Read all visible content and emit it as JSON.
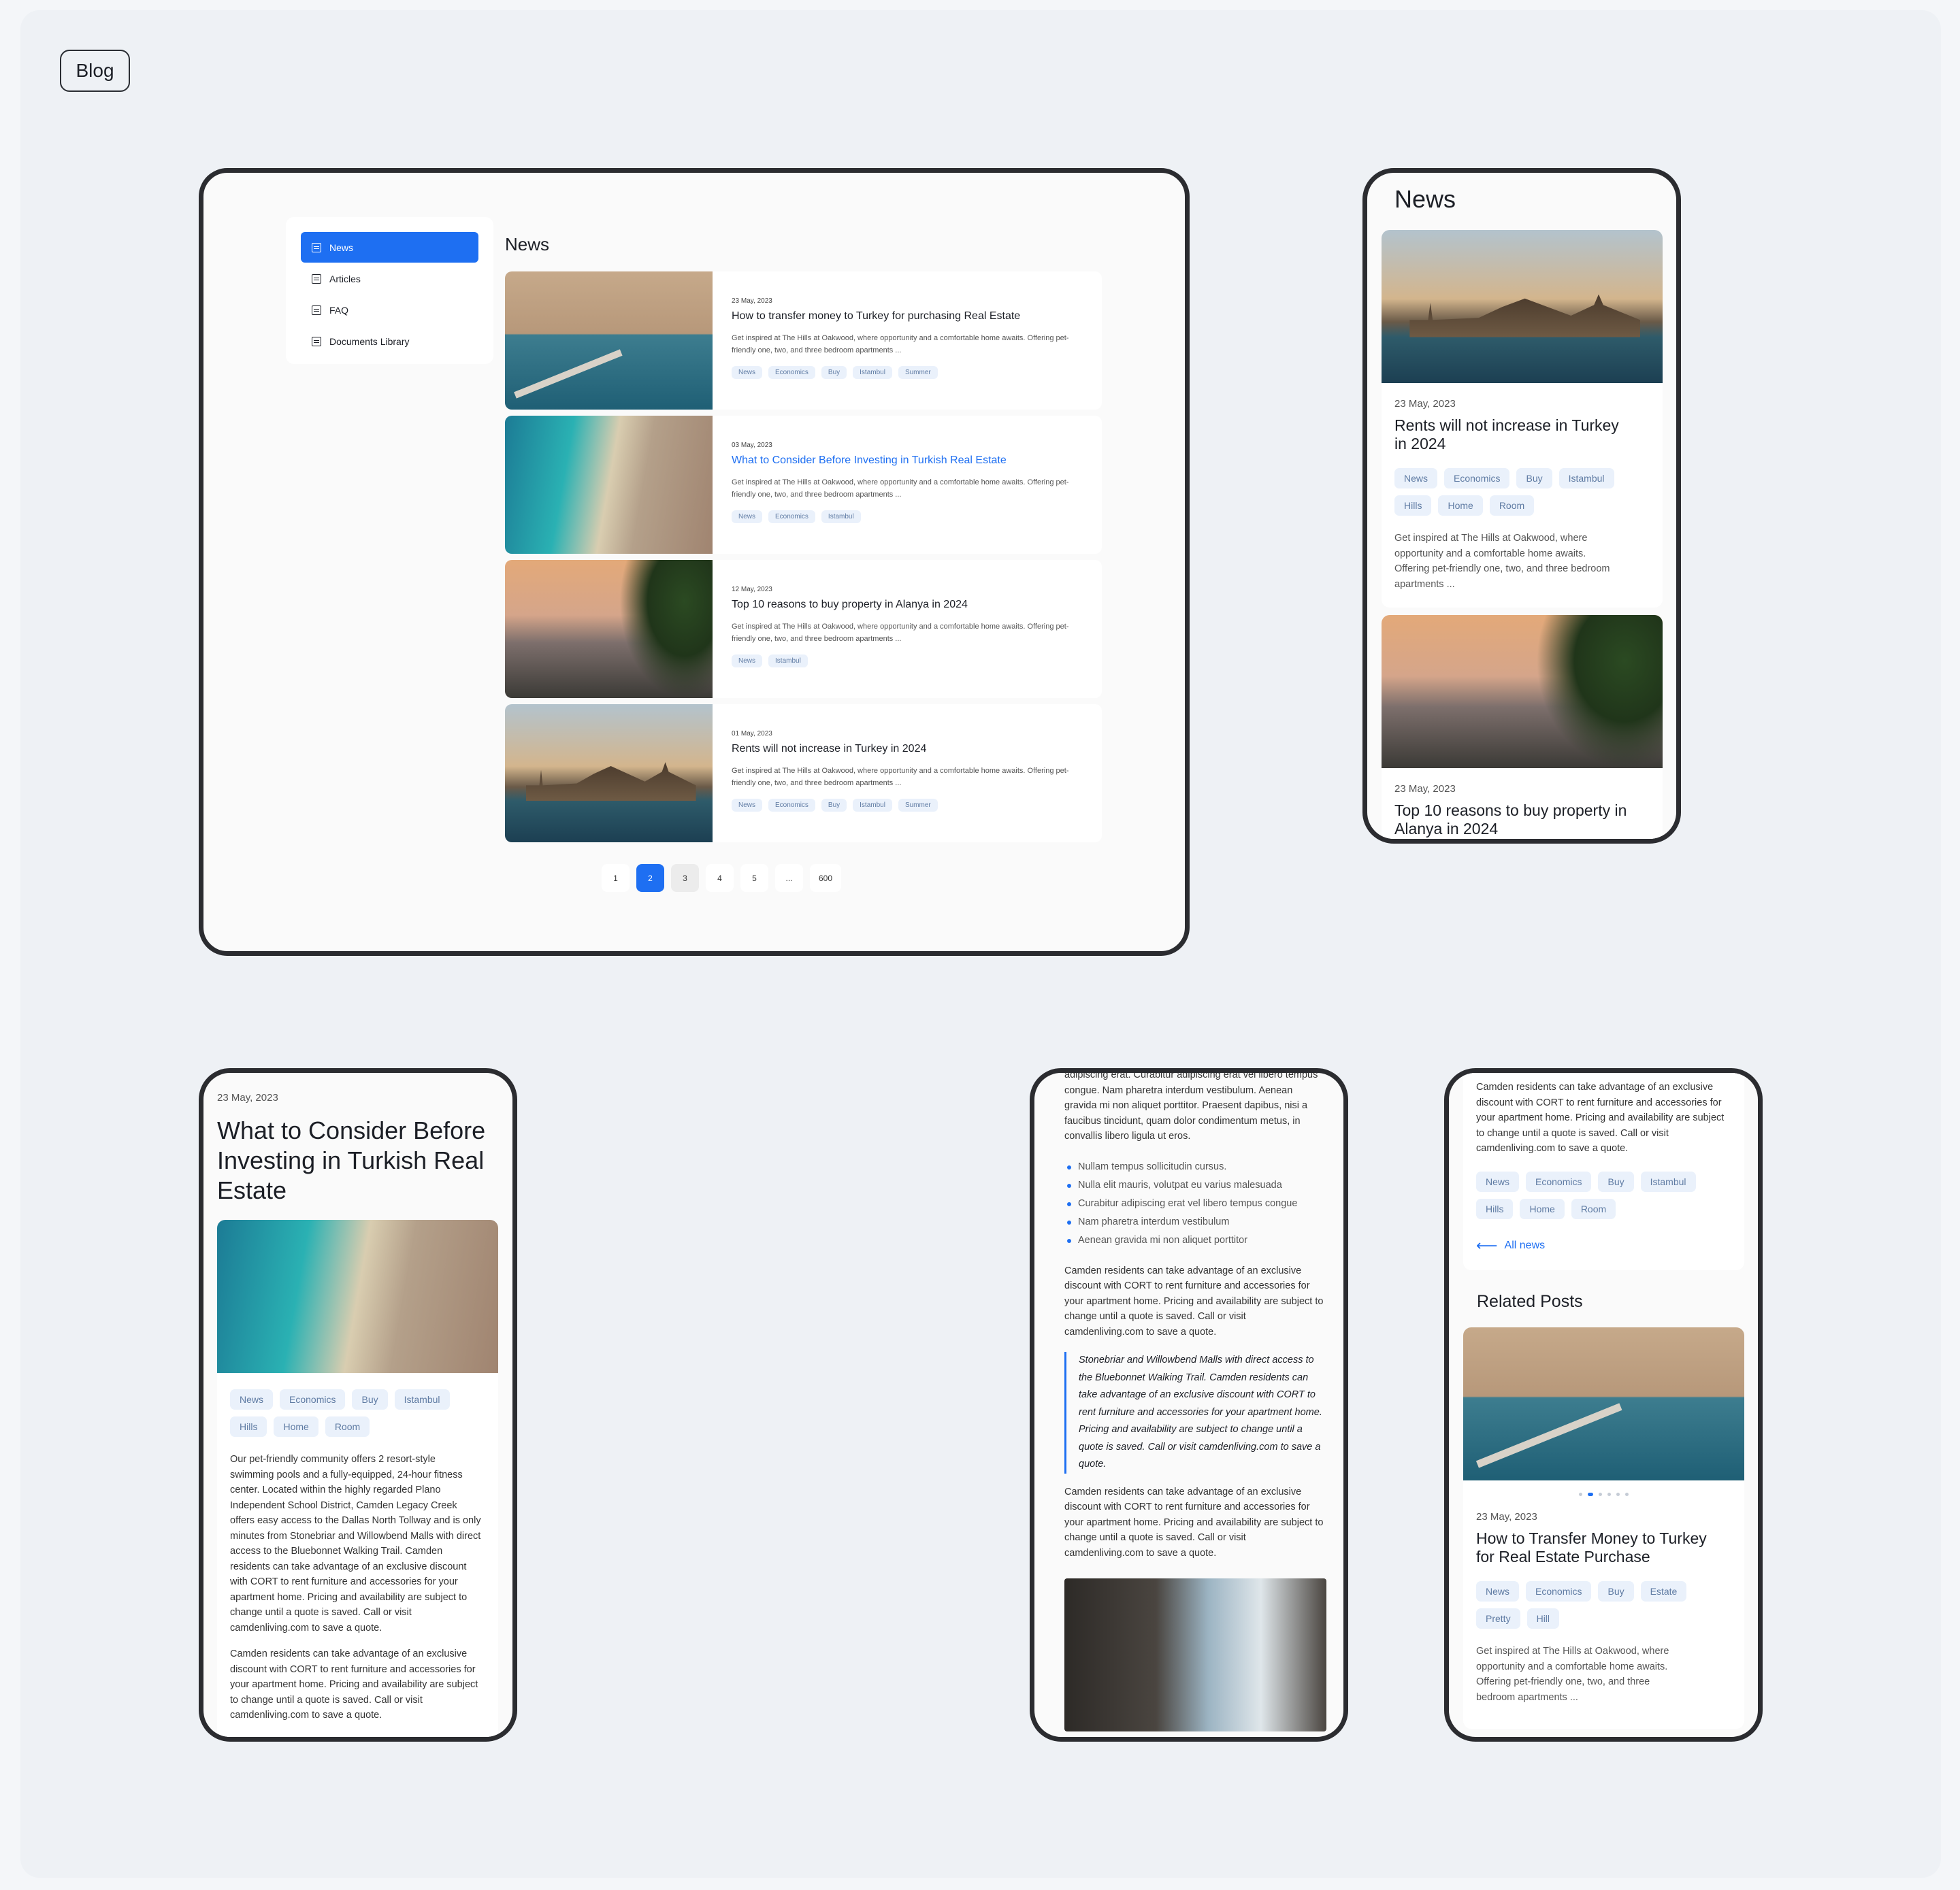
{
  "badge": "Blog",
  "desktop": {
    "sidebar": [
      {
        "label": "News",
        "icon": "newspaper-icon",
        "active": true
      },
      {
        "label": "Articles",
        "icon": "article-icon",
        "active": false
      },
      {
        "label": "FAQ",
        "icon": "question-icon",
        "active": false
      },
      {
        "label": "Documents Library",
        "icon": "archive-icon",
        "active": false
      }
    ],
    "title": "News",
    "cards": [
      {
        "date": "23 May, 2023",
        "title": "How to transfer money to Turkey for purchasing Real Estate",
        "text": "Get inspired at The Hills at Oakwood, where opportunity and a comfortable home awaits. Offering pet-friendly one, two, and three bedroom apartments ...",
        "tags": [
          "News",
          "Economics",
          "Buy",
          "Istambul",
          "Summer"
        ]
      },
      {
        "date": "03 May, 2023",
        "title": "What to Consider Before Investing in Turkish Real Estate",
        "text": "Get inspired at The Hills at Oakwood, where opportunity and a comfortable home awaits. Offering pet-friendly one, two, and three bedroom apartments ...",
        "tags": [
          "News",
          "Economics",
          "Istambul"
        ]
      },
      {
        "date": "12 May, 2023",
        "title": "Top 10 reasons to buy property in Alanya in 2024",
        "text": "Get inspired at The Hills at Oakwood, where opportunity and a comfortable home awaits. Offering pet-friendly one, two, and three bedroom apartments ...",
        "tags": [
          "News",
          "Istambul"
        ]
      },
      {
        "date": "01 May, 2023",
        "title": "Rents will not increase in Turkey in 2024",
        "text": "Get inspired at The Hills at Oakwood, where opportunity and a comfortable home awaits. Offering pet-friendly one, two, and three bedroom apartments ...",
        "tags": [
          "News",
          "Economics",
          "Buy",
          "Istambul",
          "Summer"
        ]
      }
    ],
    "pagination": [
      "1",
      "2",
      "3",
      "4",
      "5",
      "...",
      "600"
    ],
    "current_page": "2"
  },
  "mobile_news": {
    "title": "News",
    "cards": [
      {
        "date": "23 May, 2023",
        "title": "Rents will not increase in Turkey in 2024",
        "tags": [
          "News",
          "Economics",
          "Buy",
          "Istambul",
          "Hills",
          "Home",
          "Room"
        ],
        "text": "Get inspired at The Hills at Oakwood, where opportunity and a comfortable home awaits. Offering pet-friendly one, two, and three bedroom apartments ..."
      },
      {
        "date": "23 May, 2023",
        "title": "Top 10 reasons to buy property in Alanya in 2024"
      }
    ]
  },
  "mobile_article": {
    "date": "23 May, 2023",
    "title": "What to Consider Before Investing in Turkish Real Estate",
    "tags": [
      "News",
      "Economics",
      "Buy",
      "Istambul",
      "Hills",
      "Home",
      "Room"
    ],
    "p1": "Our pet-friendly community offers 2 resort-style swimming pools and a fully-equipped, 24-hour fitness center. Located within the highly regarded Plano Independent School District, Camden Legacy Creek offers easy access to the Dallas North Tollway and is only minutes from Stonebriar and Willowbend Malls with direct access to the Bluebonnet Walking Trail. Camden residents can take advantage of an exclusive discount with CORT to rent furniture and accessories for your apartment home. Pricing and availability are subject to change until a quote is saved. Call or visit camdenliving.com to save a quote.",
    "p2": "Camden residents can take advantage of an exclusive discount with CORT to rent furniture and accessories for your apartment home. Pricing and availability are subject to change until a quote is saved. Call or visit camdenliving.com to save a quote."
  },
  "mobile_body": {
    "intro": "adipiscing erat. Curabitur adipiscing erat vel libero tempus congue. Nam pharetra interdum vestibulum. Aenean gravida mi non aliquet porttitor. Praesent dapibus, nisi a faucibus tincidunt, quam dolor condimentum metus, in convallis libero ligula ut eros.",
    "bullets": [
      "Nullam tempus sollicitudin cursus.",
      "Nulla elit mauris, volutpat eu varius malesuada",
      "Curabitur adipiscing erat vel libero tempus congue",
      "Nam pharetra interdum vestibulum",
      "Aenean gravida mi non aliquet porttitor"
    ],
    "p1": "Camden residents can take advantage of an exclusive discount with CORT to rent furniture and accessories for your apartment home. Pricing and availability are subject to change until a quote is saved. Call or visit camdenliving.com to save a quote.",
    "quote": "Stonebriar and Willowbend Malls with direct access to the Bluebonnet Walking Trail. Camden residents can take advantage of an exclusive discount with CORT to rent furniture and accessories for your apartment home. Pricing and availability are subject to change until a quote is saved. Call or visit camdenliving.com to save a quote.",
    "p2": "Camden residents can take advantage of an exclusive discount with CORT to rent furniture and accessories for your apartment home. Pricing and availability are subject to change until a quote is saved. Call or visit camdenliving.com to save a quote."
  },
  "mobile_related": {
    "intro": "Camden residents can take advantage of an exclusive discount with CORT to rent furniture and accessories for your apartment home. Pricing and availability are subject to change until a quote is saved. Call or visit camdenliving.com to save a quote.",
    "tags": [
      "News",
      "Economics",
      "Buy",
      "Istambul",
      "Hills",
      "Home",
      "Room"
    ],
    "back_link": "All news",
    "related_title": "Related Posts",
    "carousel_count": 6,
    "carousel_active": 2,
    "post": {
      "date": "23 May, 2023",
      "title": "How to Transfer Money to Turkey for Real Estate Purchase",
      "tags": [
        "News",
        "Economics",
        "Buy",
        "Estate",
        "Pretty",
        "Hill"
      ],
      "text": "Get inspired at The Hills at Oakwood, where opportunity and a comfortable home awaits. Offering pet-friendly one, two, and three bedroom apartments ..."
    }
  },
  "colors": {
    "accent": "#1e6ff2",
    "tag_bg": "#eaf1fb",
    "tag_text": "#5f7ba3",
    "frame": "#2b2c30",
    "canvas": "#eef1f5"
  }
}
